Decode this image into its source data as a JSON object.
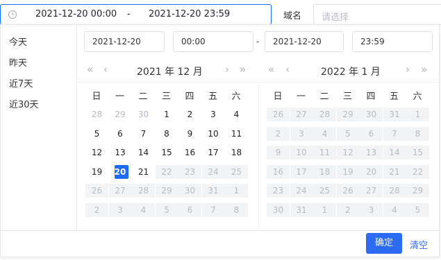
{
  "range_input": {
    "start": "2021-12-20 00:00",
    "separator": "-",
    "end": "2021-12-20 23:59"
  },
  "domain": {
    "label": "域名",
    "placeholder": "请选择"
  },
  "shortcuts": [
    "今天",
    "昨天",
    "近7天",
    "近30天"
  ],
  "fields": {
    "start_date": "2021-12-20",
    "start_time": "00:00",
    "separator": "-",
    "end_date": "2021-12-20",
    "end_time": "23:59"
  },
  "left_month": {
    "title": "2021 年 12 月",
    "weekdays": [
      "日",
      "一",
      "二",
      "三",
      "四",
      "五",
      "六"
    ],
    "rows": [
      [
        "28",
        "29",
        "30",
        "1",
        "2",
        "3",
        "4"
      ],
      [
        "5",
        "6",
        "7",
        "8",
        "9",
        "10",
        "11"
      ],
      [
        "12",
        "13",
        "14",
        "15",
        "16",
        "17",
        "18"
      ],
      [
        "19",
        "20",
        "21",
        "22",
        "23",
        "24",
        "25"
      ],
      [
        "26",
        "27",
        "28",
        "29",
        "30",
        "31",
        "1"
      ],
      [
        "2",
        "3",
        "4",
        "5",
        "6",
        "7",
        "8"
      ]
    ]
  },
  "right_month": {
    "title": "2022 年 1 月",
    "weekdays": [
      "日",
      "一",
      "二",
      "三",
      "四",
      "五",
      "六"
    ],
    "rows": [
      [
        "26",
        "27",
        "28",
        "29",
        "30",
        "31",
        "1"
      ],
      [
        "2",
        "3",
        "4",
        "5",
        "6",
        "7",
        "8"
      ],
      [
        "9",
        "10",
        "11",
        "12",
        "13",
        "14",
        "15"
      ],
      [
        "16",
        "17",
        "18",
        "19",
        "20",
        "21",
        "22"
      ],
      [
        "23",
        "24",
        "25",
        "26",
        "27",
        "28",
        "29"
      ],
      [
        "30",
        "31",
        "1",
        "2",
        "3",
        "4",
        "5"
      ]
    ]
  },
  "nav_icons": {
    "prev_year": "«",
    "prev_month": "‹",
    "next_month": "›",
    "next_year": "»"
  },
  "buttons": {
    "confirm": "确定",
    "clear": "清空"
  },
  "colors": {
    "accent": "#1e6cff",
    "in_range_bg": "#f2f3f5",
    "dim_text": "#b7bbc2"
  }
}
